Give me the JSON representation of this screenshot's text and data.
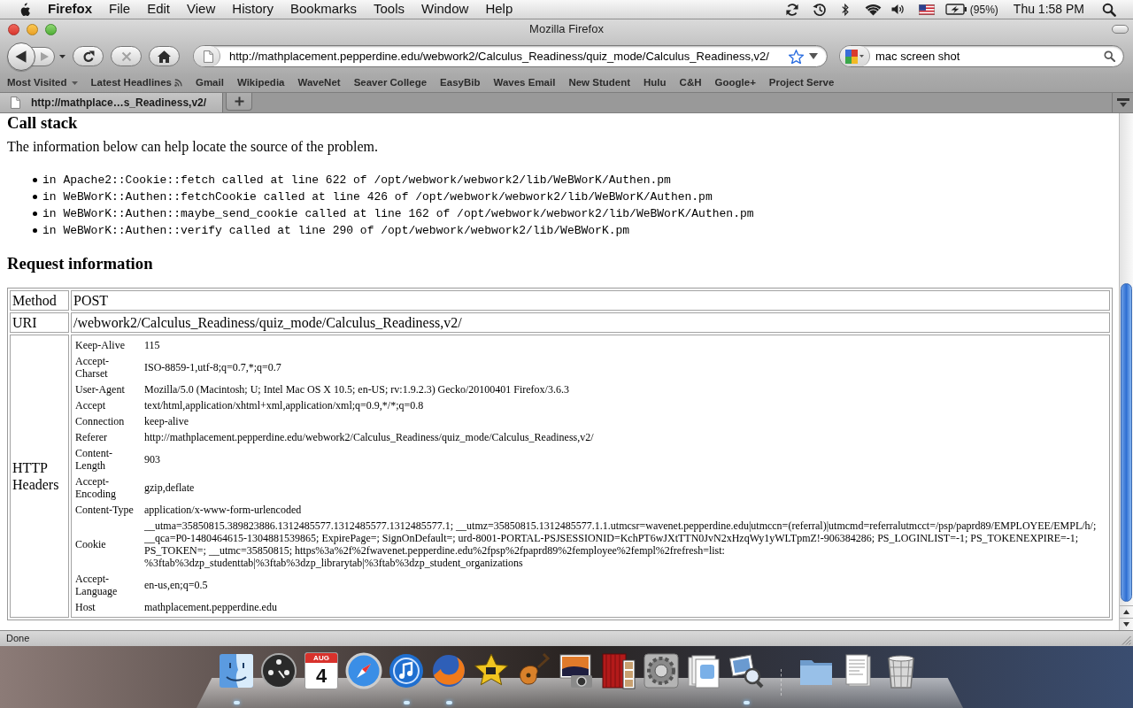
{
  "menu_bar": {
    "app_name": "Firefox",
    "menus": [
      "File",
      "Edit",
      "View",
      "History",
      "Bookmarks",
      "Tools",
      "Window",
      "Help"
    ],
    "battery": "(95%)",
    "clock": "Thu 1:58 PM"
  },
  "window": {
    "title": "Mozilla Firefox"
  },
  "nav_buttons": [
    {
      "kind": "back",
      "disabled": false
    },
    {
      "kind": "forward",
      "disabled": true
    },
    {
      "kind": "history",
      "disabled": false
    },
    {
      "kind": "reload",
      "disabled": false
    },
    {
      "kind": "stop",
      "disabled": true
    },
    {
      "kind": "home",
      "disabled": false
    }
  ],
  "address_bar": {
    "value": "http://mathplacement.pepperdine.edu/webwork2/Calculus_Readiness/quiz_mode/Calculus_Readiness,v2/"
  },
  "search_bar": {
    "value": "mac screen shot"
  },
  "bookmarks": [
    {
      "label": "Most Visited",
      "kind": "menu"
    },
    {
      "label": "Latest Headlines",
      "kind": "feed"
    },
    {
      "label": "Gmail",
      "kind": "link"
    },
    {
      "label": "Wikipedia",
      "kind": "link"
    },
    {
      "label": "WaveNet",
      "kind": "link"
    },
    {
      "label": "Seaver College",
      "kind": "link"
    },
    {
      "label": "EasyBib",
      "kind": "link"
    },
    {
      "label": "Waves Email",
      "kind": "link"
    },
    {
      "label": "New Student",
      "kind": "link"
    },
    {
      "label": "Hulu",
      "kind": "link"
    },
    {
      "label": "C&H",
      "kind": "link"
    },
    {
      "label": "Google+",
      "kind": "link"
    },
    {
      "label": "Project Serve",
      "kind": "link"
    }
  ],
  "tabs": [
    {
      "label": "http://mathplace…s_Readiness,v2/",
      "selected": true
    }
  ],
  "page": {
    "call_stack": {
      "heading": "Call stack",
      "intro": "The information below can help locate the source of the problem.",
      "frames": [
        "in Apache2::Cookie::fetch called at line 622 of /opt/webwork/webwork2/lib/WeBWorK/Authen.pm",
        "in WeBWorK::Authen::fetchCookie called at line 426 of /opt/webwork/webwork2/lib/WeBWorK/Authen.pm",
        "in WeBWorK::Authen::maybe_send_cookie called at line 162 of /opt/webwork/webwork2/lib/WeBWorK/Authen.pm",
        "in WeBWorK::Authen::verify called at line 290 of /opt/webwork/webwork2/lib/WeBWorK.pm"
      ]
    },
    "request_information": {
      "heading": "Request information",
      "rows": [
        {
          "kind": "text",
          "label": "Method",
          "value": "POST"
        },
        {
          "kind": "text",
          "label": "URI",
          "value": "/webwork2/Calculus_Readiness/quiz_mode/Calculus_Readiness,v2/"
        },
        {
          "kind": "headers",
          "label": "HTTP Headers",
          "headers": [
            {
              "name": "Keep-Alive",
              "value": "115"
            },
            {
              "name": "Accept-Charset",
              "value": "ISO-8859-1,utf-8;q=0.7,*;q=0.7"
            },
            {
              "name": "User-Agent",
              "value": "Mozilla/5.0 (Macintosh; U; Intel Mac OS X 10.5; en-US; rv:1.9.2.3) Gecko/20100401 Firefox/3.6.3"
            },
            {
              "name": "Accept",
              "value": "text/html,application/xhtml+xml,application/xml;q=0.9,*/*;q=0.8"
            },
            {
              "name": "Connection",
              "value": "keep-alive"
            },
            {
              "name": "Referer",
              "value": "http://mathplacement.pepperdine.edu/webwork2/Calculus_Readiness/quiz_mode/Calculus_Readiness,v2/"
            },
            {
              "name": "Content-Length",
              "value": "903"
            },
            {
              "name": "Accept-Encoding",
              "value": "gzip,deflate"
            },
            {
              "name": "Content-Type",
              "value": "application/x-www-form-urlencoded"
            },
            {
              "name": "Cookie",
              "value": "__utma=35850815.389823886.1312485577.1312485577.1312485577.1; __utmz=35850815.1312485577.1.1.utmcsr=wavenet.pepperdine.edu|utmccn=(referral)|utmcmd=referralutmcct=/psp/paprd89/EMPLOYEE/EMPL/h/; __qca=P0-1480464615-1304881539865; ExpirePage=; SignOnDefault=; urd-8001-PORTAL-PSJSESSIONID=KchPT6wJXtTTN0JvN2xHzqWy1yWLTpmZ!-906384286; PS_LOGINLIST=-1; PS_TOKENEXPIRE=-1; PS_TOKEN=; __utmc=35850815; https%3a%2f%2fwavenet.pepperdine.edu%2fpsp%2fpaprd89%2femployee%2fempl%2frefresh=list: %3ftab%3dzp_studenttab|%3ftab%3dzp_librarytab|%3ftab%3dzp_student_organizations"
            },
            {
              "name": "Accept-Language",
              "value": "en-us,en;q=0.5"
            },
            {
              "name": "Host",
              "value": "mathplacement.pepperdine.edu"
            }
          ]
        }
      ]
    }
  },
  "status_bar": {
    "text": "Done"
  },
  "dock": {
    "applications": [
      {
        "kind": "finder",
        "running": true
      },
      {
        "kind": "dashboard",
        "running": false
      },
      {
        "kind": "calendar",
        "running": false,
        "month": "AUG",
        "day": "4"
      },
      {
        "kind": "safari",
        "running": false
      },
      {
        "kind": "itunes",
        "running": true
      },
      {
        "kind": "firefox",
        "running": true
      },
      {
        "kind": "imovie",
        "running": false
      },
      {
        "kind": "garageband",
        "running": false
      },
      {
        "kind": "iphoto",
        "running": false
      },
      {
        "kind": "photobooth",
        "running": false
      },
      {
        "kind": "preferences",
        "running": false
      },
      {
        "kind": "app_stack",
        "running": false
      },
      {
        "kind": "preview",
        "running": true
      }
    ],
    "stacks": [
      {
        "kind": "folder",
        "running": false
      },
      {
        "kind": "documents",
        "running": false
      },
      {
        "kind": "trash",
        "running": false
      }
    ]
  }
}
